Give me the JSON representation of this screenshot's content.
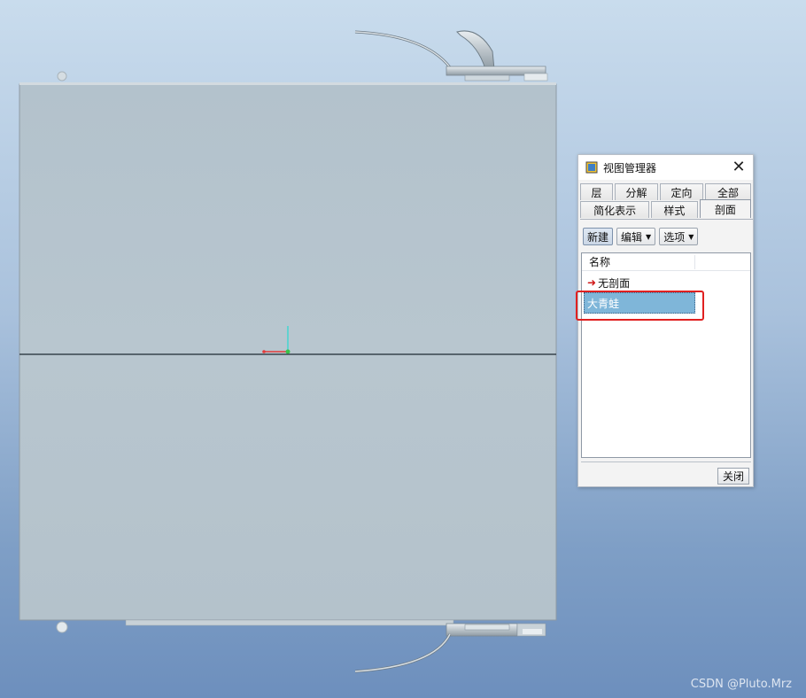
{
  "dialog": {
    "title": "视图管理器",
    "tabs_row1": [
      "层",
      "分解",
      "定向",
      "全部"
    ],
    "tabs_row2": [
      "简化表示",
      "样式",
      "剖面"
    ],
    "active_tab": "剖面",
    "toolbar": {
      "new_label": "新建",
      "edit_label": "编辑",
      "options_label": "选项"
    },
    "list": {
      "header": "名称",
      "items": [
        "无剖面",
        "大青蛙"
      ],
      "selected": "大青蛙"
    },
    "close_label": "关闭"
  },
  "watermark": "CSDN @Pluto.Mrz",
  "colors": {
    "selection": "#7fb6d9",
    "highlight_box": "#e02020",
    "model_face": "#b5c3cd"
  },
  "icons": {
    "title": "view-manager-icon",
    "close": "close-icon",
    "no_section": "red-arrow-icon"
  }
}
